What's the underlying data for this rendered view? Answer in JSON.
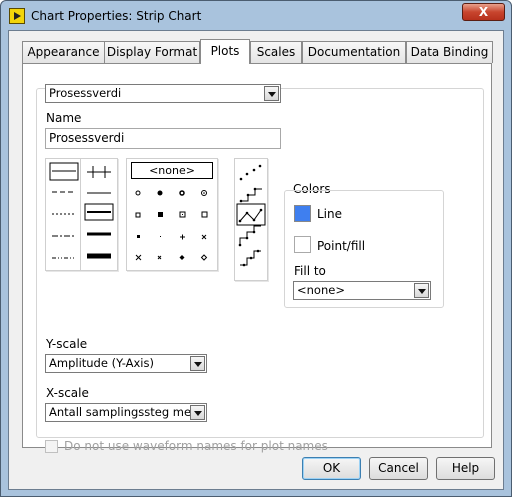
{
  "window": {
    "title": "Chart Properties: Strip Chart",
    "close_glyph": "X"
  },
  "tabs": [
    {
      "label": "Appearance",
      "active": false
    },
    {
      "label": "Display Format",
      "active": false
    },
    {
      "label": "Plots",
      "active": true
    },
    {
      "label": "Scales",
      "active": false
    },
    {
      "label": "Documentation",
      "active": false
    },
    {
      "label": "Data Binding",
      "active": false
    }
  ],
  "plots": {
    "plot_select": "Prosessverdi",
    "name_label": "Name",
    "name_value": "Prosessverdi",
    "point_style_none": "<none>",
    "colors": {
      "title": "Colors",
      "line_label": "Line",
      "line_color": "#3f7fef",
      "point_fill_label": "Point/fill",
      "point_fill_color": "#ffffff",
      "fill_to_label": "Fill to",
      "fill_to_value": "<none>"
    },
    "yscale_label": "Y-scale",
    "yscale_value": "Amplitude (Y-Axis)",
    "xscale_label": "X-scale",
    "xscale_value": "Antall samplingssteg med",
    "waveform_checkbox_label": "Do not use waveform names for plot names",
    "waveform_checkbox_checked": false
  },
  "buttons": {
    "ok": "OK",
    "cancel": "Cancel",
    "help": "Help"
  }
}
